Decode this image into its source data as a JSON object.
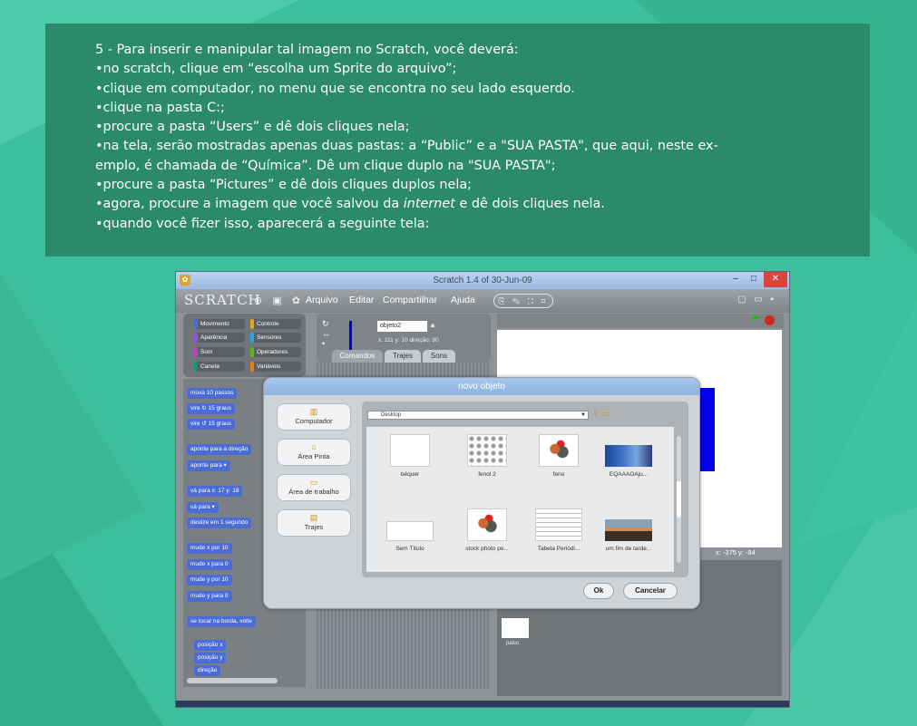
{
  "instructions": {
    "lines": [
      "5 -  Para inserir e manipular tal imagem no Scratch, você deverá:",
      "•no scratch, clique em “escolha um Sprite do arquivo”;",
      "•clique em computador, no menu que se encontra no seu lado esquerdo.",
      "•clique na pasta C:;",
      "•procure a pasta “Users” e dê dois cliques nela;",
      "•na tela, serão mostradas apenas duas pastas: a “Public” e a \"SUA PASTA\", que aqui, neste ex-",
      "emplo, é chamada de “Química”. Dê um clique duplo na \"SUA PASTA\";",
      "•procure a pasta “Pictures” e dê dois cliques duplos nela;",
      "•agora, procure a imagem que você salvou da ",
      "internet",
      " e dê dois cliques nela.",
      "•quando você fizer isso, aparecerá a seguinte tela:"
    ]
  },
  "window": {
    "title": "Scratch 1.4 of 30-Jun-09",
    "min": "–",
    "max": "□",
    "close": "✕"
  },
  "menubar": {
    "logo": "SCRATCH",
    "icons": "⊕ ▣ ✿",
    "items": [
      "Arquivo",
      "Editar",
      "Compartilhar",
      "Ajuda"
    ],
    "tools": "⎘ ✎ ⛶ ⌗",
    "views": "▢ ▭ ▪"
  },
  "categories": [
    {
      "label": "Movimento",
      "color": "#4a6cd4"
    },
    {
      "label": "Controle",
      "color": "#e1a91a"
    },
    {
      "label": "Aparência",
      "color": "#8a55d7"
    },
    {
      "label": "Sensores",
      "color": "#2ca5e2"
    },
    {
      "label": "Som",
      "color": "#bb42c3"
    },
    {
      "label": "Operadores",
      "color": "#5cb712"
    },
    {
      "label": "Caneta",
      "color": "#0e9a6c"
    },
    {
      "label": "Variáveis",
      "color": "#ee7d16"
    }
  ],
  "blocks": [
    "mova 10 passos",
    "vire ↻ 15 graus",
    "vire ↺ 15 graus",
    "aponte para a direção",
    "aponte para ▾",
    "vá para x: 17 y: 18",
    "vá para ▾",
    "deslize em 1 segundo",
    "mude x por 10",
    "mude x para 0",
    "mude y por 10",
    "mude y para 0",
    "se tocar na borda, volte",
    "posição x",
    "posição y",
    "direção"
  ],
  "sprite": {
    "name": "objeto2",
    "coords": "x: 111  y: 10   direção: 90"
  },
  "tabs": [
    "Comandos",
    "Trajes",
    "Sons"
  ],
  "stage": {
    "mouse": "x: -375   y: -84",
    "thumb_label": "palco"
  },
  "dialog": {
    "title": "novo objeto",
    "nav": [
      {
        "icon": "▥",
        "label": "Computador"
      },
      {
        "icon": "⌂",
        "label": "Área Pinta"
      },
      {
        "icon": "▭",
        "label": "Área de trabalho"
      },
      {
        "icon": "▤",
        "label": "Trajes"
      }
    ],
    "path": "Desktop",
    "path_icons": "⇧ ▭",
    "files": [
      "béquer",
      "fenol 2",
      "feno",
      "EQAAAOAju...",
      "Sem Título",
      "stock photo po...",
      "Tabela Periódi...",
      "um fim de tarde..."
    ],
    "ok": "Ok",
    "cancel": "Cancelar"
  }
}
